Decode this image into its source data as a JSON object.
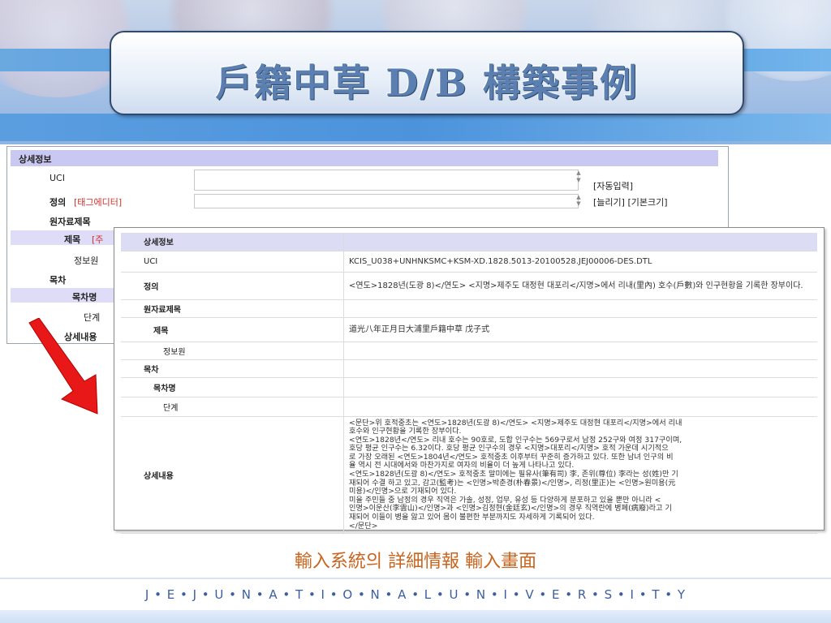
{
  "slide": {
    "title": "戶籍中草 D/B 構築事例",
    "caption": "輸入系統의 詳細情報 輸入畫面",
    "footer": "J • E • J • U • N • A • T • I • O • N • A • L • U • N • I • V • E • R • S • I • T • Y"
  },
  "back_form": {
    "section_title": "상세정보",
    "uci_label": "UCI",
    "uci_action": "[자동입력]",
    "definition_label": "정의",
    "definition_tag": "[태그에디터]",
    "definition_actions": "[늘리기] [기본크기]",
    "original_title_label": "원자료제목",
    "title_label": "제목",
    "title_tag_partial": "[주",
    "info_partial": "정보원",
    "toc_label": "목차",
    "toc_name_label": "목차명",
    "level_label": "단계",
    "detail_label": "상세내용"
  },
  "detail": {
    "section_title": "상세정보",
    "rows": {
      "uci": {
        "label": "UCI",
        "value": "KCIS_U038+UNHNKSMC+KSM-XD.1828.5013-20100528.JEJ00006-DES.DTL"
      },
      "definition": {
        "label": "정의",
        "value": "<연도>1828년(도광 8)</연도> <지명>제주도 대정현 대포리</지명>에서 리내(里內) 호수(戶數)와 인구현황을 기록한 장부이다."
      },
      "original_title": {
        "label": "원자료제목"
      },
      "title": {
        "label": "제목",
        "value": "道光八年正月日大浦里戶籍中草 戊子式"
      },
      "source": {
        "label": "정보원"
      },
      "toc": {
        "label": "목차"
      },
      "toc_name": {
        "label": "목차명"
      },
      "level": {
        "label": "단계"
      },
      "detail_content": {
        "label": "상세내용",
        "lines": [
          "<문단>위 호적중초는 <연도>1828년(도광 8)</연도> <지명>제주도 대정현 대포리</지명>에서 리내",
          "호수와 인구현황을 기록한 장부이다.",
          "<연도>1828년</연도> 리내 호수는 90호로, 도합 인구수는 569구로서 남정 252구와 여정 317구이며,",
          "호당 평균 인구수는 6.32이다. 호당 평균 인구수의 경우 <지명>대포리</지명> 호적 가운데 시기적으",
          "로 가장 오래된 <연도>1804년</연도> 호적중초 이후부터 꾸준히 증가하고 있다. 또한 남녀 인구의 비",
          "율 역시 전 시대에서와 마찬가지로 여자의 비율이 더 높게 나타나고 있다.",
          "<연도>1828년(도광 8)</연도> 호적중초 말미에는 필유사(筆有司) 李, 존위(尊位) 李라는 성(姓)만 기",
          "재되어 수결 하고 있고, 감고(監考)는 <인명>박춘경(朴春景)</인명>, 리정(里正)는 <인명>원미용(元",
          "미용)</인명>으로 기재되어 있다.",
          "미을 주민들 중 남정의 경우 직역은 가솔, 성정, 업무, 유성 등 다양하게 분포하고 있을 뿐만 아니라 <",
          "인명>이운산(李雲山)</인명>과 <인명>김정현(金廷玄)</인명>의 경우 직역란에 병폐(病廢)라고 기",
          "재되어 이들이 병을 앓고 있어 몸이 불편한 부분까지도 자세하게 기록되어 있다.",
          "</문단>"
        ]
      }
    }
  },
  "colors": {
    "accent_red": "#d0302b",
    "header_blue": "#4c93dc",
    "section_lavender": "#dcdcf4",
    "caption_orange": "#c8641e",
    "footer_blue": "#3a5fa0"
  }
}
